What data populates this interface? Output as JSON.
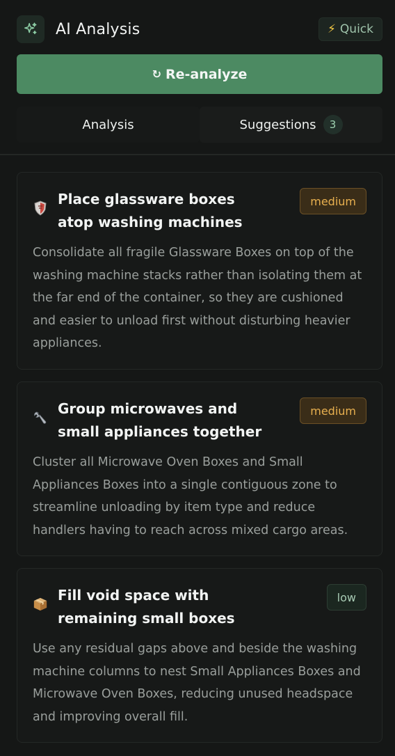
{
  "header": {
    "title": "AI Analysis",
    "quick_label": "Quick",
    "ai_icon": "sparkles-icon",
    "bolt_icon": "lightning-icon"
  },
  "actions": {
    "reanalyze_label": "Re-analyze",
    "reanalyze_glyph": "↻"
  },
  "tabs": [
    {
      "label": "Analysis",
      "active": false
    },
    {
      "label": "Suggestions",
      "count": "3",
      "active": true
    }
  ],
  "colors": {
    "background": "#151716",
    "accent": "#4c8a62",
    "medium": "#e8b04f",
    "low": "#a8cbb4"
  },
  "suggestions": [
    {
      "icon": "shield-icon",
      "title": "Place glassware boxes atop washing machines",
      "priority": "medium",
      "description": "Consolidate all fragile Glassware Boxes on top of the washing machine stacks rather than isolating them at the far end of the container, so they are cushioned and easier to unload first without disturbing heavier appliances."
    },
    {
      "icon": "wrench-icon",
      "title": "Group microwaves and small appliances together",
      "priority": "medium",
      "description": "Cluster all Microwave Oven Boxes and Small Appliances Boxes into a single contiguous zone to streamline unloading by item type and reduce handlers having to reach across mixed cargo areas."
    },
    {
      "icon": "package-icon",
      "title": "Fill void space with remaining small boxes",
      "priority": "low",
      "description": "Use any residual gaps above and beside the washing machine columns to nest Small Appliances Boxes and Microwave Oven Boxes, reducing unused headspace and improving overall fill."
    }
  ]
}
